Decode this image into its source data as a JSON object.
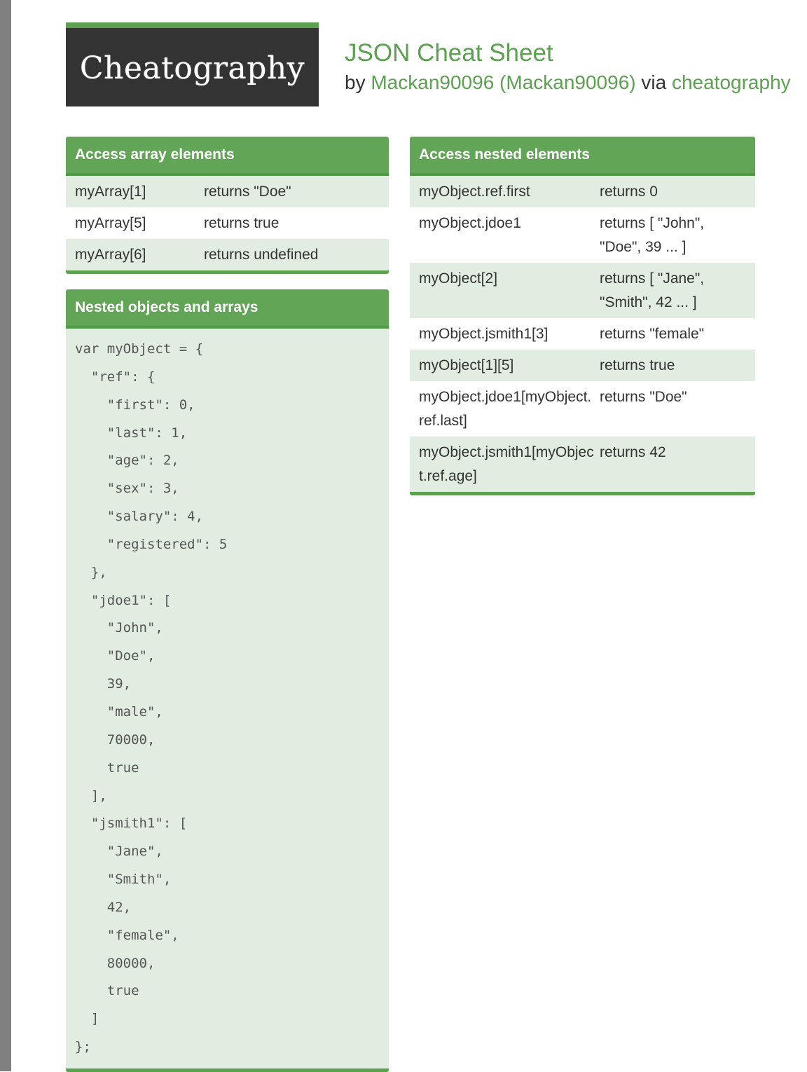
{
  "header": {
    "logo_text": "Cheatography",
    "title": "JSON Cheat Sheet",
    "by_label": "by",
    "author": "Mackan90096 (Mackan90096)",
    "via_label": "via",
    "site": "cheatography"
  },
  "array_box": {
    "title": "Access array elements",
    "rows": [
      {
        "expr": "myArray[1]",
        "result": "returns \"Doe\""
      },
      {
        "expr": "myArray[5]",
        "result": "returns true"
      },
      {
        "expr": "myArray[6]",
        "result": "returns undefined"
      }
    ]
  },
  "nested_box": {
    "title": "Access nested elements",
    "rows": [
      {
        "expr": "myObject.ref.first",
        "result": "returns 0"
      },
      {
        "expr": "myObject.jdoe1",
        "result": "returns [ \"John\", \"Doe\", 39 ... ]"
      },
      {
        "expr": "myObject[2]",
        "result": "returns [ \"Jane\", \"Smith\", 42 ... ]"
      },
      {
        "expr": "myObject.jsmith1[3]",
        "result": "returns \"female\""
      },
      {
        "expr": "myObject[1][5]",
        "result": "returns true"
      },
      {
        "expr": "myObject.jdoe1[myObject.ref.last]",
        "result": "returns \"Doe\""
      },
      {
        "expr": "myObject.jsmith1[myObject.ref.age]",
        "result": "returns 42"
      }
    ]
  },
  "code_box": {
    "title": "Nested objects and arrays",
    "lines": [
      "var myObject = {",
      "  \"ref\": {",
      "    \"first\": 0,",
      "    \"last\": 1,",
      "    \"age\": 2,",
      "    \"sex\": 3,",
      "    \"salary\": 4,",
      "    \"registered\": 5",
      "  },",
      "  \"jdoe1\": [",
      "    \"John\",",
      "    \"Doe\",",
      "    39,",
      "    \"male\",",
      "    70000,",
      "    true",
      "  ],",
      "  \"jsmith1\": [",
      "    \"Jane\",",
      "    \"Smith\",",
      "    42,",
      "    \"female\",",
      "    80000,",
      "    true",
      "  ]",
      "};"
    ]
  }
}
